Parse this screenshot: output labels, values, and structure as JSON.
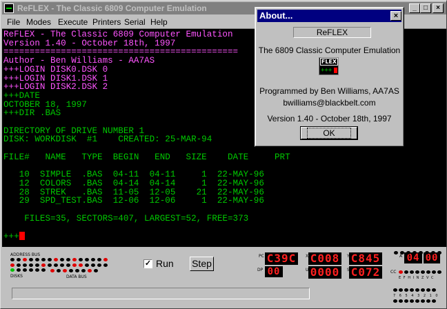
{
  "window": {
    "title": "ReFLEX - The Classic 6809 Computer Emulation",
    "minimize": "_",
    "maximize": "□",
    "close": "×"
  },
  "menu": [
    "File",
    "Modes",
    "Execute",
    "Printers",
    "Serial",
    "Help"
  ],
  "terminal": {
    "lines": [
      {
        "text": "ReFLEX - The Classic 6809 Computer Emulation",
        "color": "magenta"
      },
      {
        "text": "Version 1.40 - October 18th, 1997",
        "color": "magenta"
      },
      {
        "text": "=============================================",
        "color": "magenta"
      },
      {
        "text": "Author - Ben Williams - AA7AS",
        "color": "magenta"
      },
      {
        "text": "+++LOGIN DISK0.DSK 0",
        "color": "magenta"
      },
      {
        "text": "+++LOGIN DISK1.DSK 1",
        "color": "magenta"
      },
      {
        "text": "+++LOGIN DISK2.DSK 2",
        "color": "magenta"
      },
      {
        "text": "+++DATE",
        "color": "green"
      },
      {
        "text": "OCTOBER 18, 1997",
        "color": "green"
      },
      {
        "text": "+++DIR .BAS",
        "color": "green"
      },
      {
        "text": "",
        "color": "green"
      },
      {
        "text": "DIRECTORY OF DRIVE NUMBER 1",
        "color": "green"
      },
      {
        "text": "DISK: WORKDISK  #1    CREATED: 25-MAR-94",
        "color": "green"
      },
      {
        "text": "",
        "color": "green"
      },
      {
        "text": "FILE#   NAME   TYPE  BEGIN   END   SIZE    DATE     PRT",
        "color": "green"
      },
      {
        "text": "",
        "color": "green"
      },
      {
        "text": "   10  SIMPLE  .BAS  04-11  04-11     1  22-MAY-96",
        "color": "green"
      },
      {
        "text": "   12  COLORS  .BAS  04-14  04-14     1  22-MAY-96",
        "color": "green"
      },
      {
        "text": "   28  STREK   .BAS  11-05  12-05    21  22-MAY-96",
        "color": "green"
      },
      {
        "text": "   29  SPD_TEST.BAS  12-06  12-06     1  22-MAY-96",
        "color": "green"
      },
      {
        "text": "",
        "color": "green"
      },
      {
        "text": "    FILES=35, SECTORS=407, LARGEST=52, FREE=373",
        "color": "green"
      },
      {
        "text": "",
        "color": "green"
      },
      {
        "text": "+++",
        "color": "green",
        "cursor": true
      }
    ]
  },
  "panel": {
    "address_bus_label": "ADDRESS BUS",
    "disks_label": "DISKS",
    "data_bus_label": "DATA BUS",
    "run_label": "Run",
    "run_checked": true,
    "step_label": "Step",
    "registers": [
      {
        "label": "PC",
        "value": "C39C"
      },
      {
        "label": "DP",
        "value": "00"
      },
      {
        "label": "X",
        "value": "C008"
      },
      {
        "label": "U",
        "value": "0000"
      },
      {
        "label": "Y",
        "value": "C845"
      },
      {
        "label": "S",
        "value": "C072"
      },
      {
        "label": "A",
        "value": "04"
      },
      {
        "label": "B",
        "value": "00"
      }
    ],
    "cc_label": "CC",
    "cc_flags": "E F H I N Z V C",
    "bit_numbers": "7 6 5 4 3 2 1 0"
  },
  "about": {
    "title": "About...",
    "close": "×",
    "name_field": "ReFLEX",
    "subtitle": "The 6809 Classic Computer Emulation",
    "logo_word": "FLEX",
    "logo_prompt": "+++",
    "programmed_by": "Programmed by Ben Williams, AA7AS",
    "email": "bwilliams@blackbelt.com",
    "version": "Version 1.40 - October 18th, 1997",
    "ok_label": "OK"
  }
}
